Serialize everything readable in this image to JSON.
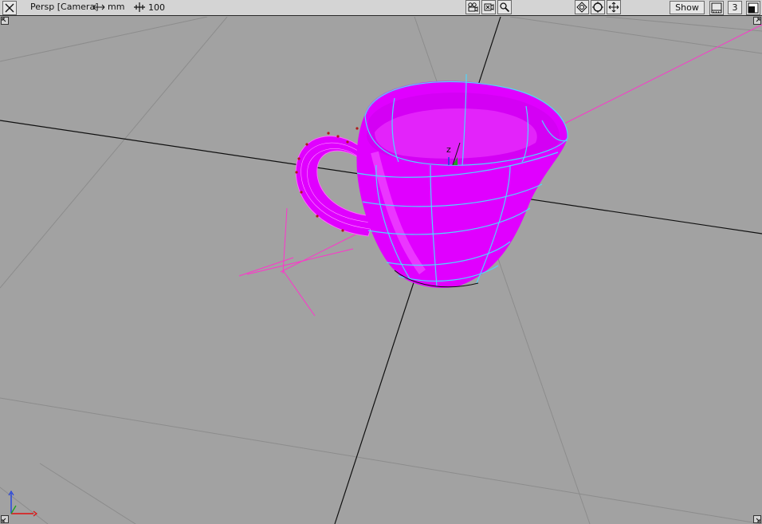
{
  "toolbar": {
    "view_label": "Persp [Camera]",
    "units_label": "mm",
    "grid_size": "100",
    "show_label": "Show",
    "layout_number": "3",
    "icons": {
      "close": "close-x-icon",
      "units": "double-arrow-icon",
      "grid": "grid-cross-icon",
      "camera": "camera-icon",
      "film": "film-camera-icon",
      "zoom": "magnifier-icon",
      "display_a": "rotate-view-icon",
      "display_b": "circle-frame-icon",
      "display_c": "move-arrows-icon",
      "layout": "layout-icon",
      "maximize": "maximize-icon"
    }
  },
  "viewport": {
    "z_label": "z",
    "colors": {
      "background": "#a2a2a2",
      "grid_line": "#8c8c8c",
      "axis_line": "#101010",
      "surface": "#e000ff",
      "isoparm": "#4fd6ff",
      "camera_rig": "#ff33cc",
      "cv_point": "#b11a1a"
    }
  },
  "axis_indicator": {
    "x_color": "#e01010",
    "y_color": "#20a020",
    "z_color": "#2040e0"
  }
}
